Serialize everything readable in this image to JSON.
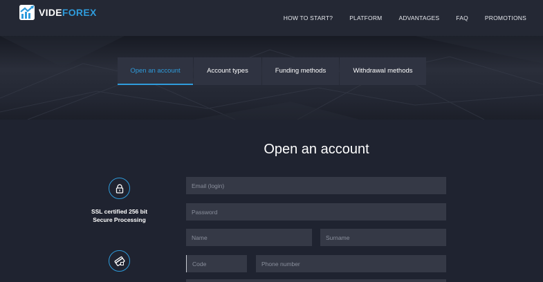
{
  "brand": {
    "name_part1": "VIDE",
    "name_part2": "FOREX",
    "accent": "#2f9cdc"
  },
  "nav": {
    "items": [
      {
        "label": "HOW TO START?"
      },
      {
        "label": "PLATFORM"
      },
      {
        "label": "ADVANTAGES"
      },
      {
        "label": "FAQ"
      },
      {
        "label": "PROMOTIONS"
      }
    ]
  },
  "tabs": [
    {
      "label": "Open an account",
      "active": true
    },
    {
      "label": "Account types"
    },
    {
      "label": "Funding methods"
    },
    {
      "label": "Withdrawal methods"
    }
  ],
  "form": {
    "title": "Open an account",
    "email_placeholder": "Email (login)",
    "password_placeholder": "Password",
    "name_placeholder": "Name",
    "surname_placeholder": "Surname",
    "code_placeholder": "Code",
    "phone_placeholder": "Phone number"
  },
  "security": {
    "line1": "SSL certified 256 bit",
    "line2": "Secure Processing",
    "icons": [
      "lock-icon",
      "card-icon"
    ]
  }
}
